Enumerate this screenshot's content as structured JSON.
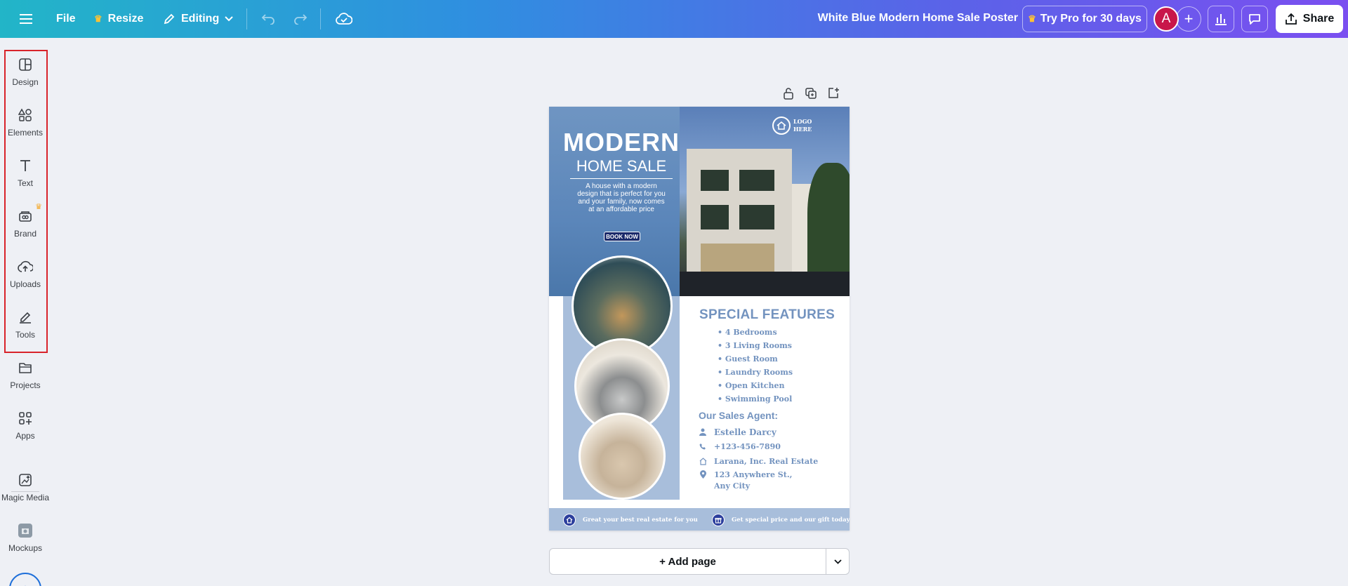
{
  "topbar": {
    "file_label": "File",
    "resize_label": "Resize",
    "editing_label": "Editing",
    "doc_title": "White Blue Modern Home Sale Poster",
    "pro_label": "Try Pro for 30 days",
    "avatar_letter": "A",
    "share_label": "Share"
  },
  "sidebar": {
    "items": [
      {
        "label": "Design",
        "icon": "design-icon"
      },
      {
        "label": "Elements",
        "icon": "elements-icon"
      },
      {
        "label": "Text",
        "icon": "text-icon"
      },
      {
        "label": "Brand",
        "icon": "brand-icon"
      },
      {
        "label": "Uploads",
        "icon": "uploads-icon"
      },
      {
        "label": "Tools",
        "icon": "tools-icon"
      },
      {
        "label": "Projects",
        "icon": "folder-icon"
      },
      {
        "label": "Apps",
        "icon": "apps-icon"
      },
      {
        "label": "Magic Media",
        "icon": "magic-media-icon"
      },
      {
        "label": "Mockups",
        "icon": "mockups-icon"
      }
    ]
  },
  "poster": {
    "title": "MODERN",
    "subtitle": "HOME SALE",
    "description": "A house with a modern design that is perfect for you and your family, now comes at an affordable price",
    "book_now": "BOOK NOW",
    "logo_line1": "LOGO",
    "logo_line2": "HERE",
    "features_title": "SPECIAL FEATURES",
    "features": [
      "• 4 Bedrooms",
      "• 3 Living Rooms",
      "• Guest Room",
      "• Laundry Rooms",
      "• Open Kitchen",
      "• Swimming Pool"
    ],
    "agent_title": "Our Sales Agent:",
    "agent_name": "Estelle Darcy",
    "agent_phone": "+123-456-7890",
    "agent_company": "Larana, Inc. Real Estate",
    "agent_address": "123 Anywhere St., Any City",
    "footer_left": "Great your best real estate for you",
    "footer_right": "Get special price and our gift today"
  },
  "canvas": {
    "add_page_label": "+ Add page"
  },
  "colors": {
    "accent": "#7393bf",
    "highlight": "#d8232a",
    "avatar": "#c8174a"
  }
}
